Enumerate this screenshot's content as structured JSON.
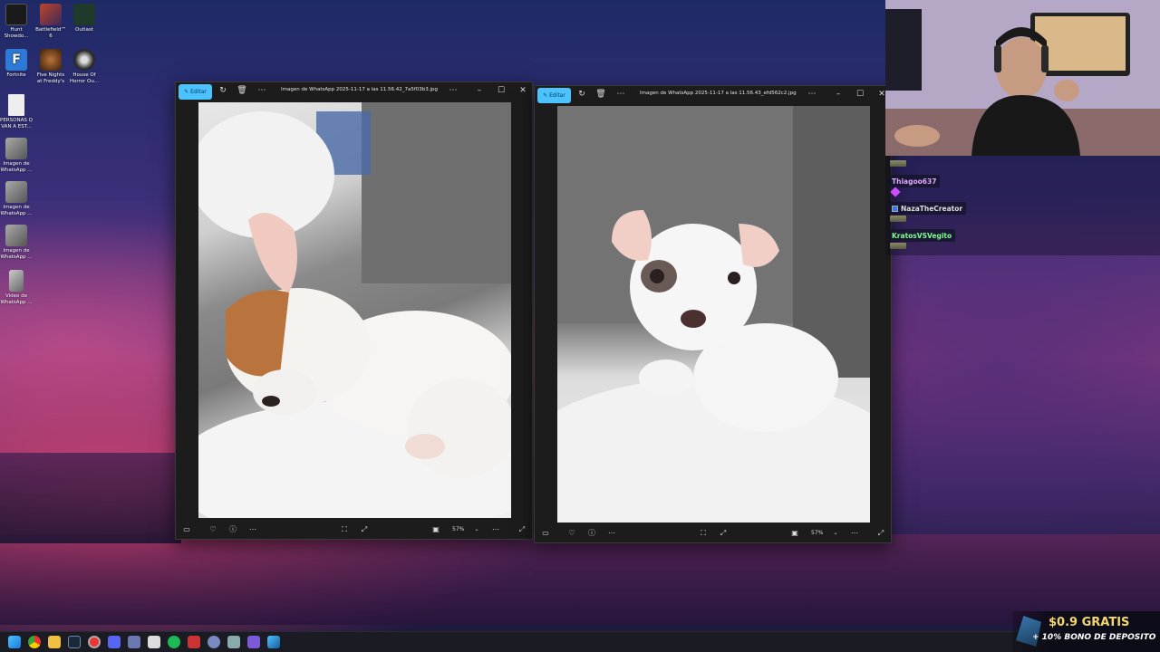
{
  "desktop": {
    "icons": [
      {
        "label": "Hunt Showdo...",
        "color": "#1a1a1a"
      },
      {
        "label": "Battlefield™ 6",
        "color": "#c0442a"
      },
      {
        "label": "Outlast",
        "color": "#1f3a2a"
      },
      {
        "label": "Fortnite",
        "color": "#2d7ad6"
      },
      {
        "label": "Five Nights at Freddy's",
        "color": "#6a3a1a"
      },
      {
        "label": "House Of Horror Ou...",
        "color": "#2a2a2a"
      },
      {
        "label": "PERSONAS Q VAN A EST...",
        "color": "#eeeeee"
      },
      {
        "label": "Imagen de WhatsApp ...",
        "color": "#8a8a8a"
      },
      {
        "label": "Imagen de WhatsApp ...",
        "color": "#8a8a8a"
      },
      {
        "label": "Imagen de WhatsApp ...",
        "color": "#8a8a8a"
      },
      {
        "label": "Video de WhatsApp ...",
        "color": "#8a8a8a"
      }
    ]
  },
  "window1": {
    "edit_label": "Editar",
    "title": "Imagen de WhatsApp 2025-11-17 a las 11.56.42_7a5f03b3.jpg",
    "zoom": "57%"
  },
  "window2": {
    "edit_label": "Editar",
    "title": "Imagen de WhatsApp 2025-11-17 a las 11.56.43_efd562c2.jpg",
    "zoom": "57%"
  },
  "chat": {
    "users": [
      {
        "name": "Thiagoo637",
        "color": "#e2a8ff"
      },
      {
        "name": "NazaTheCreator",
        "color": "#dddddd"
      },
      {
        "name": "KratosVSVegito",
        "color": "#7dff8a"
      }
    ]
  },
  "promo": {
    "line1": "$0.9 GRATIS",
    "line2": "+ 10% BONO DE DEPOSITO"
  },
  "colors": {
    "accent": "#4cc2ff",
    "window_bg": "#1c1c1c",
    "taskbar_bg": "#1b1b24",
    "promo_yellow": "#f5d86a"
  }
}
